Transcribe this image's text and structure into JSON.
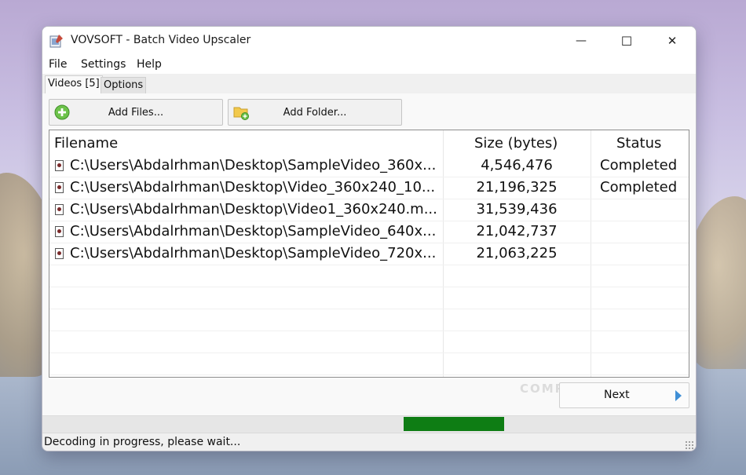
{
  "window": {
    "title": "VOVSOFT - Batch Video Upscaler",
    "controls": {
      "minimize": "—",
      "maximize": "☐",
      "close": "✕"
    }
  },
  "menu": [
    "File",
    "Settings",
    "Help"
  ],
  "tabs": [
    {
      "label": "Videos [5]",
      "active": true
    },
    {
      "label": "Options",
      "active": false
    }
  ],
  "toolbar": {
    "add_files": "Add Files...",
    "add_folder": "Add Folder..."
  },
  "table": {
    "columns": [
      "Filename",
      "Size (bytes)",
      "Status"
    ],
    "rows": [
      {
        "filename": "C:\\Users\\Abdalrhman\\Desktop\\SampleVideo_360x...",
        "size": "4,546,476",
        "status": "Completed"
      },
      {
        "filename": "C:\\Users\\Abdalrhman\\Desktop\\Video_360x240_10...",
        "size": "21,196,325",
        "status": "Completed"
      },
      {
        "filename": "C:\\Users\\Abdalrhman\\Desktop\\Video1_360x240.m...",
        "size": "31,539,436",
        "status": ""
      },
      {
        "filename": "C:\\Users\\Abdalrhman\\Desktop\\SampleVideo_640x...",
        "size": "21,042,737",
        "status": ""
      },
      {
        "filename": "C:\\Users\\Abdalrhman\\Desktop\\SampleVideo_720x...",
        "size": "21,063,225",
        "status": ""
      }
    ]
  },
  "next_button": "Next",
  "watermark": "COMPUTERVID.COM",
  "progress": {
    "start": 0.555,
    "end": 0.71,
    "color": "#0e7d14",
    "style": "marquee"
  },
  "status_text": "Decoding in progress, please wait...",
  "colors": {
    "progress": "#0e7d14",
    "accent": "#3f8fd6"
  }
}
